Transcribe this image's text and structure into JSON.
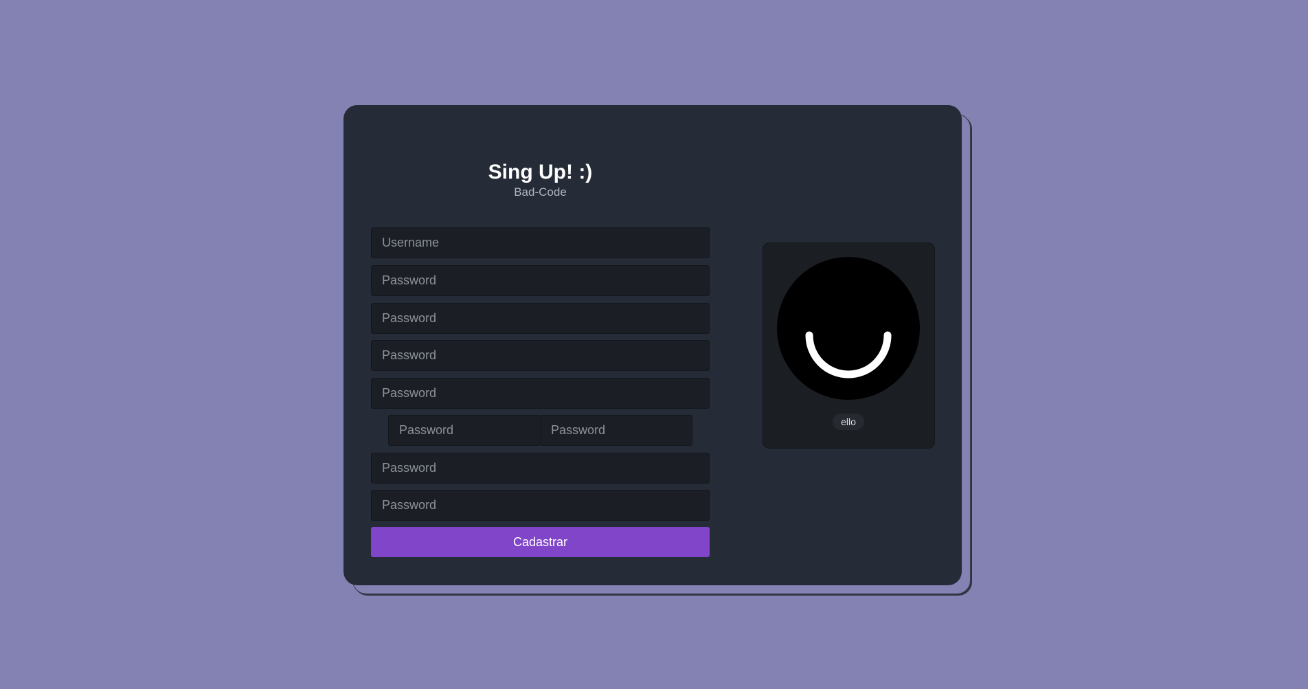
{
  "form": {
    "title": "Sing Up! :)",
    "subtitle": "Bad-Code",
    "fields": [
      "Username",
      "Password",
      "Password",
      "Password",
      "Password",
      "Password",
      "Password",
      "Password",
      "Password"
    ],
    "submit_label": "Cadastrar"
  },
  "avatar": {
    "logo_icon": "smile-logo-icon",
    "badge_label": "ello"
  },
  "colors": {
    "background": "#8481b3",
    "card": "#262c37",
    "field": "#1b1f25",
    "accent": "#8045c9"
  }
}
